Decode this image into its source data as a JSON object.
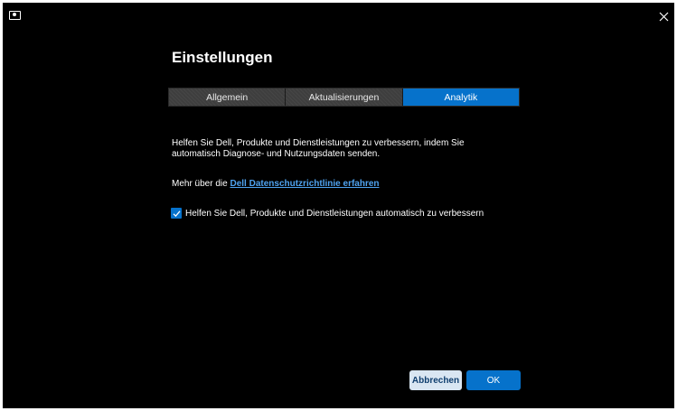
{
  "window": {
    "close_icon": "close-icon",
    "app_icon": "monitor-icon"
  },
  "page": {
    "title": "Einstellungen"
  },
  "tabs": [
    {
      "label": "Allgemein",
      "active": false
    },
    {
      "label": "Aktualisierungen",
      "active": false
    },
    {
      "label": "Analytik",
      "active": true
    }
  ],
  "analytics": {
    "description": "Helfen Sie Dell, Produkte und Dienstleistungen zu verbessern, indem Sie automatisch Diagnose- und Nutzungsdaten senden.",
    "privacy_prefix": "Mehr über die ",
    "privacy_link": "Dell Datenschutzrichtlinie erfahren",
    "checkbox_label": "Helfen Sie Dell, Produkte und Dienstleistungen automatisch zu verbessern",
    "checkbox_checked": true
  },
  "buttons": {
    "cancel": "Abbrechen",
    "ok": "OK"
  },
  "colors": {
    "accent": "#0672cb",
    "link": "#4fa3f0",
    "background": "#000000"
  }
}
